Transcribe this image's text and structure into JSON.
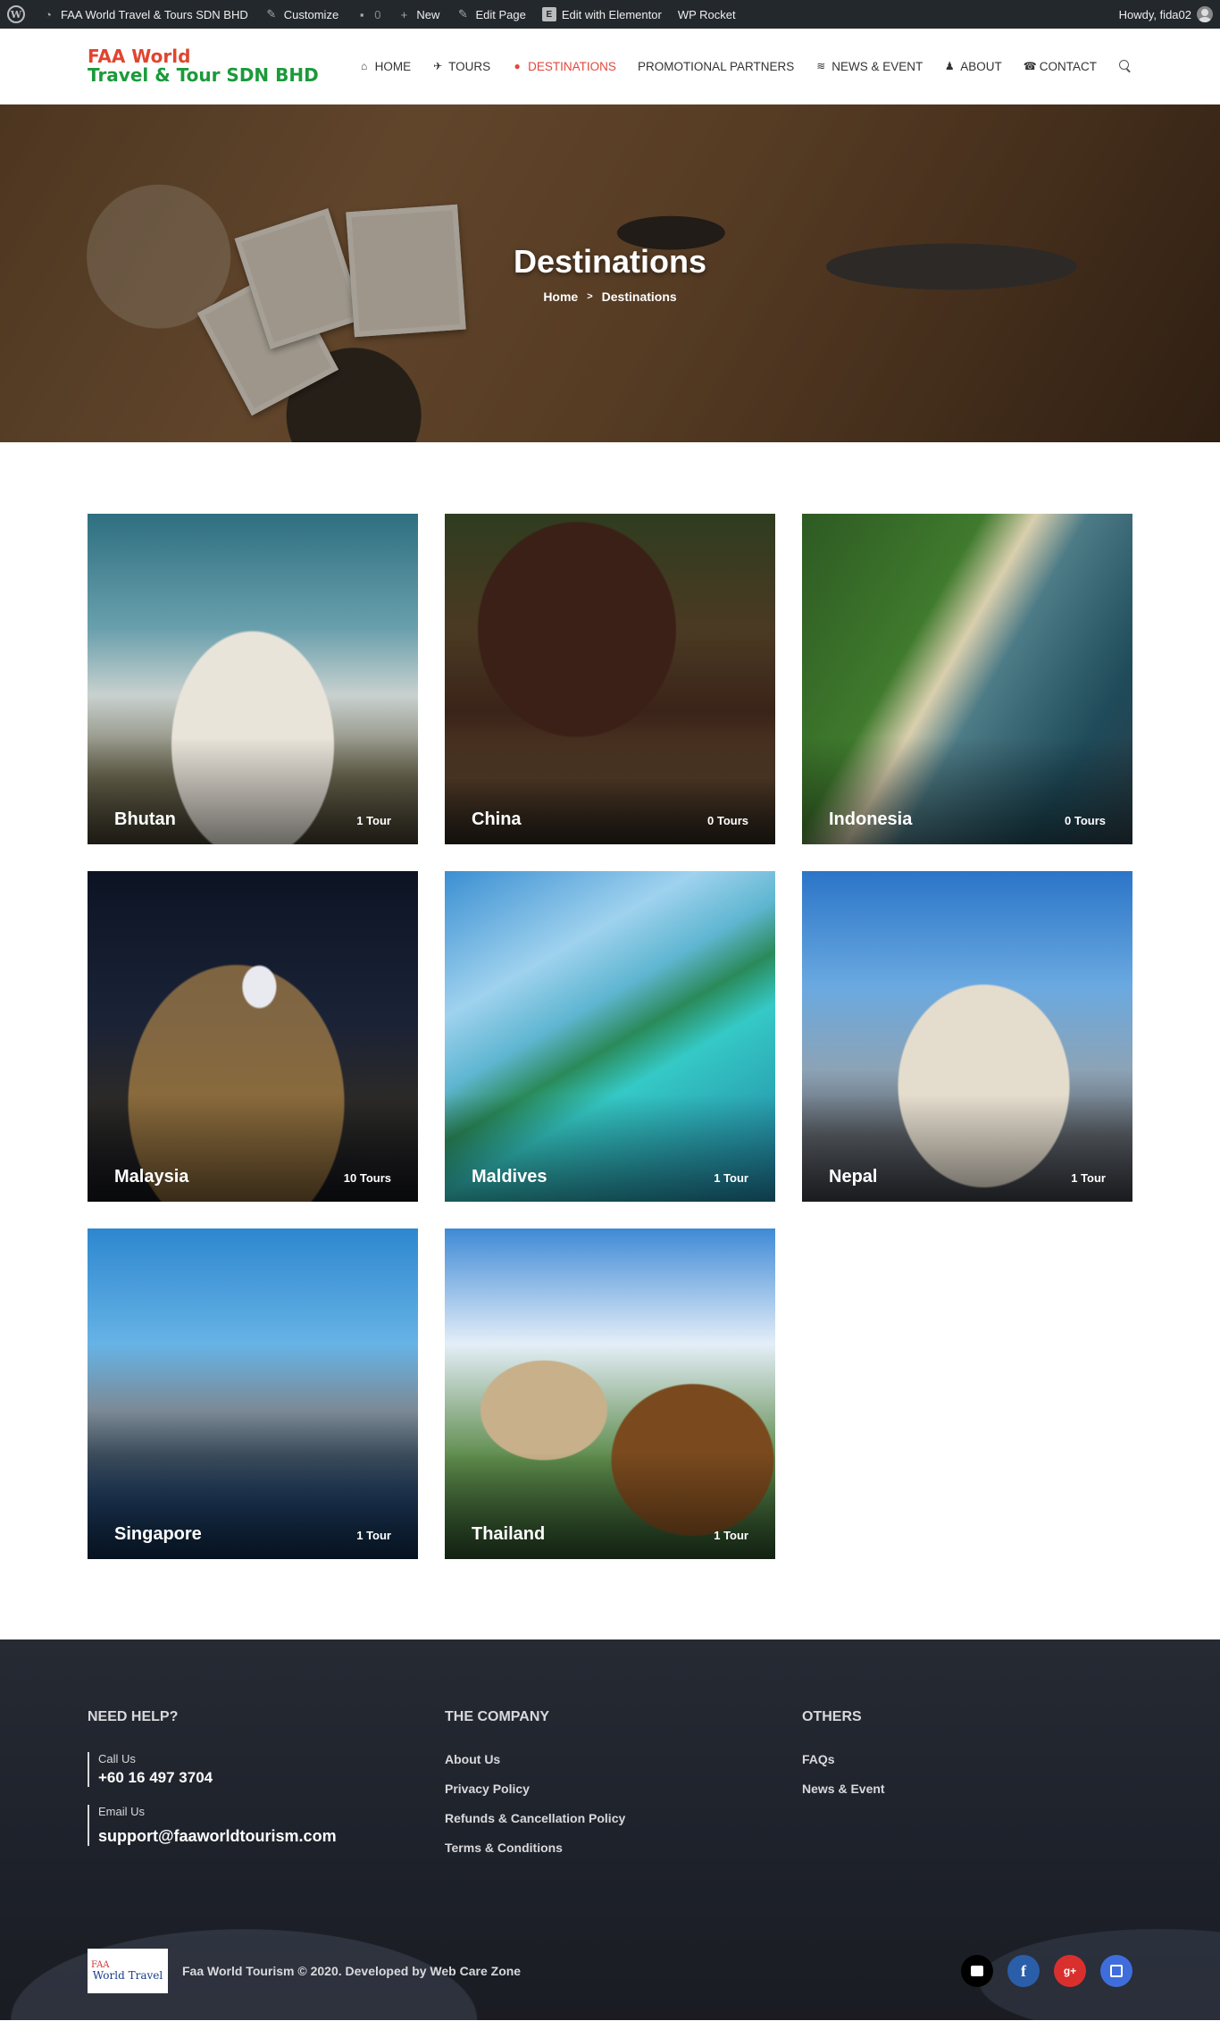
{
  "adminbar": {
    "site_name": "FAA World Travel & Tours SDN BHD",
    "customize": "Customize",
    "comments_count": "0",
    "new": "New",
    "edit_page": "Edit Page",
    "edit_elementor": "Edit with Elementor",
    "wp_rocket": "WP Rocket",
    "howdy": "Howdy, fida02"
  },
  "header": {
    "logo_line1": "FAA World",
    "logo_line2": "Travel & Tour SDN BHD",
    "nav": [
      {
        "label": "HOME",
        "icon": "home-icon"
      },
      {
        "label": "TOURS",
        "icon": "plane-icon"
      },
      {
        "label": "DESTINATIONS",
        "icon": "map-marker-icon",
        "active": true
      },
      {
        "label": "PROMOTIONAL PARTNERS"
      },
      {
        "label": "NEWS & EVENT",
        "icon": "rss-icon"
      },
      {
        "label": "ABOUT",
        "icon": "user-icon"
      },
      {
        "label": "CONTACT",
        "icon": "phone-icon"
      }
    ]
  },
  "hero": {
    "title": "Destinations",
    "breadcrumb_home": "Home",
    "breadcrumb_sep": ">",
    "breadcrumb_current": "Destinations"
  },
  "destinations": [
    {
      "name": "Bhutan",
      "tours": "1 Tour"
    },
    {
      "name": "China",
      "tours": "0 Tours"
    },
    {
      "name": "Indonesia",
      "tours": "0 Tours"
    },
    {
      "name": "Malaysia",
      "tours": "10 Tours"
    },
    {
      "name": "Maldives",
      "tours": "1 Tour"
    },
    {
      "name": "Nepal",
      "tours": "1 Tour"
    },
    {
      "name": "Singapore",
      "tours": "1 Tour"
    },
    {
      "name": "Thailand",
      "tours": "1 Tour"
    }
  ],
  "footer": {
    "need_help": {
      "heading": "NEED HELP?",
      "call_label": "Call Us",
      "call_value": "+60 16 497 3704",
      "email_label": "Email Us",
      "email_value": "support@faaworldtourism.com"
    },
    "company": {
      "heading": "THE COMPANY",
      "links": [
        "About Us",
        "Privacy Policy",
        "Refunds & Cancellation Policy",
        "Terms & Conditions"
      ]
    },
    "others": {
      "heading": "OTHERS",
      "links": [
        "FAQs",
        "News & Event"
      ]
    },
    "logo_top": "FAA",
    "logo_text": "World Travel",
    "copyright": "Faa World Tourism © 2020. Developed by Web Care Zone",
    "socials": [
      {
        "name": "email-icon",
        "color": "#000000"
      },
      {
        "name": "facebook-icon",
        "glyph": "f",
        "color": "#2a5ea8"
      },
      {
        "name": "google-plus-icon",
        "glyph": "g+",
        "color": "#d9302e"
      },
      {
        "name": "calendar-icon",
        "color": "#3f6edc"
      }
    ]
  },
  "colors": {
    "accent": "#e2473a",
    "logo_red": "#e0452f",
    "logo_green": "#1b9a3a",
    "adminbar": "#23282d"
  }
}
